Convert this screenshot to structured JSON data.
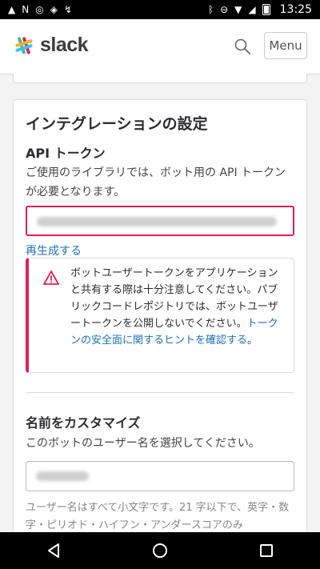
{
  "statusbar": {
    "time": "13:25"
  },
  "appbar": {
    "logo_text": "slack",
    "menu_label": "Menu",
    "icons": [
      "search-icon"
    ]
  },
  "settings": {
    "title": "インテグレーションの設定",
    "api_section_title": "API トークン",
    "api_description": "ご使用のライブラリでは、ボット用の API トークンが必要となります。",
    "api_token_value": "",
    "regenerate_label": "再生成する",
    "warning": {
      "text": "ボットユーザートークンをアプリケーションと共有する際は十分注意してください。パブリックコードレポジトリでは、ボットユーザートークンを公開しないでください。",
      "link_text": "トークンの安全面に関するヒントを確認する",
      "suffix": "。"
    },
    "name_section_title": "名前をカスタマイズ",
    "name_description": "このボットのユーザー名を選択してください。",
    "username_value": "",
    "footer_text": "ユーザー名はすべて小文字です。21 字以下で、英字・数字・ピリオド・ハイフン・アンダースコアのみ"
  },
  "colors": {
    "accent": "#e01e5a",
    "link": "#1d72b8"
  }
}
